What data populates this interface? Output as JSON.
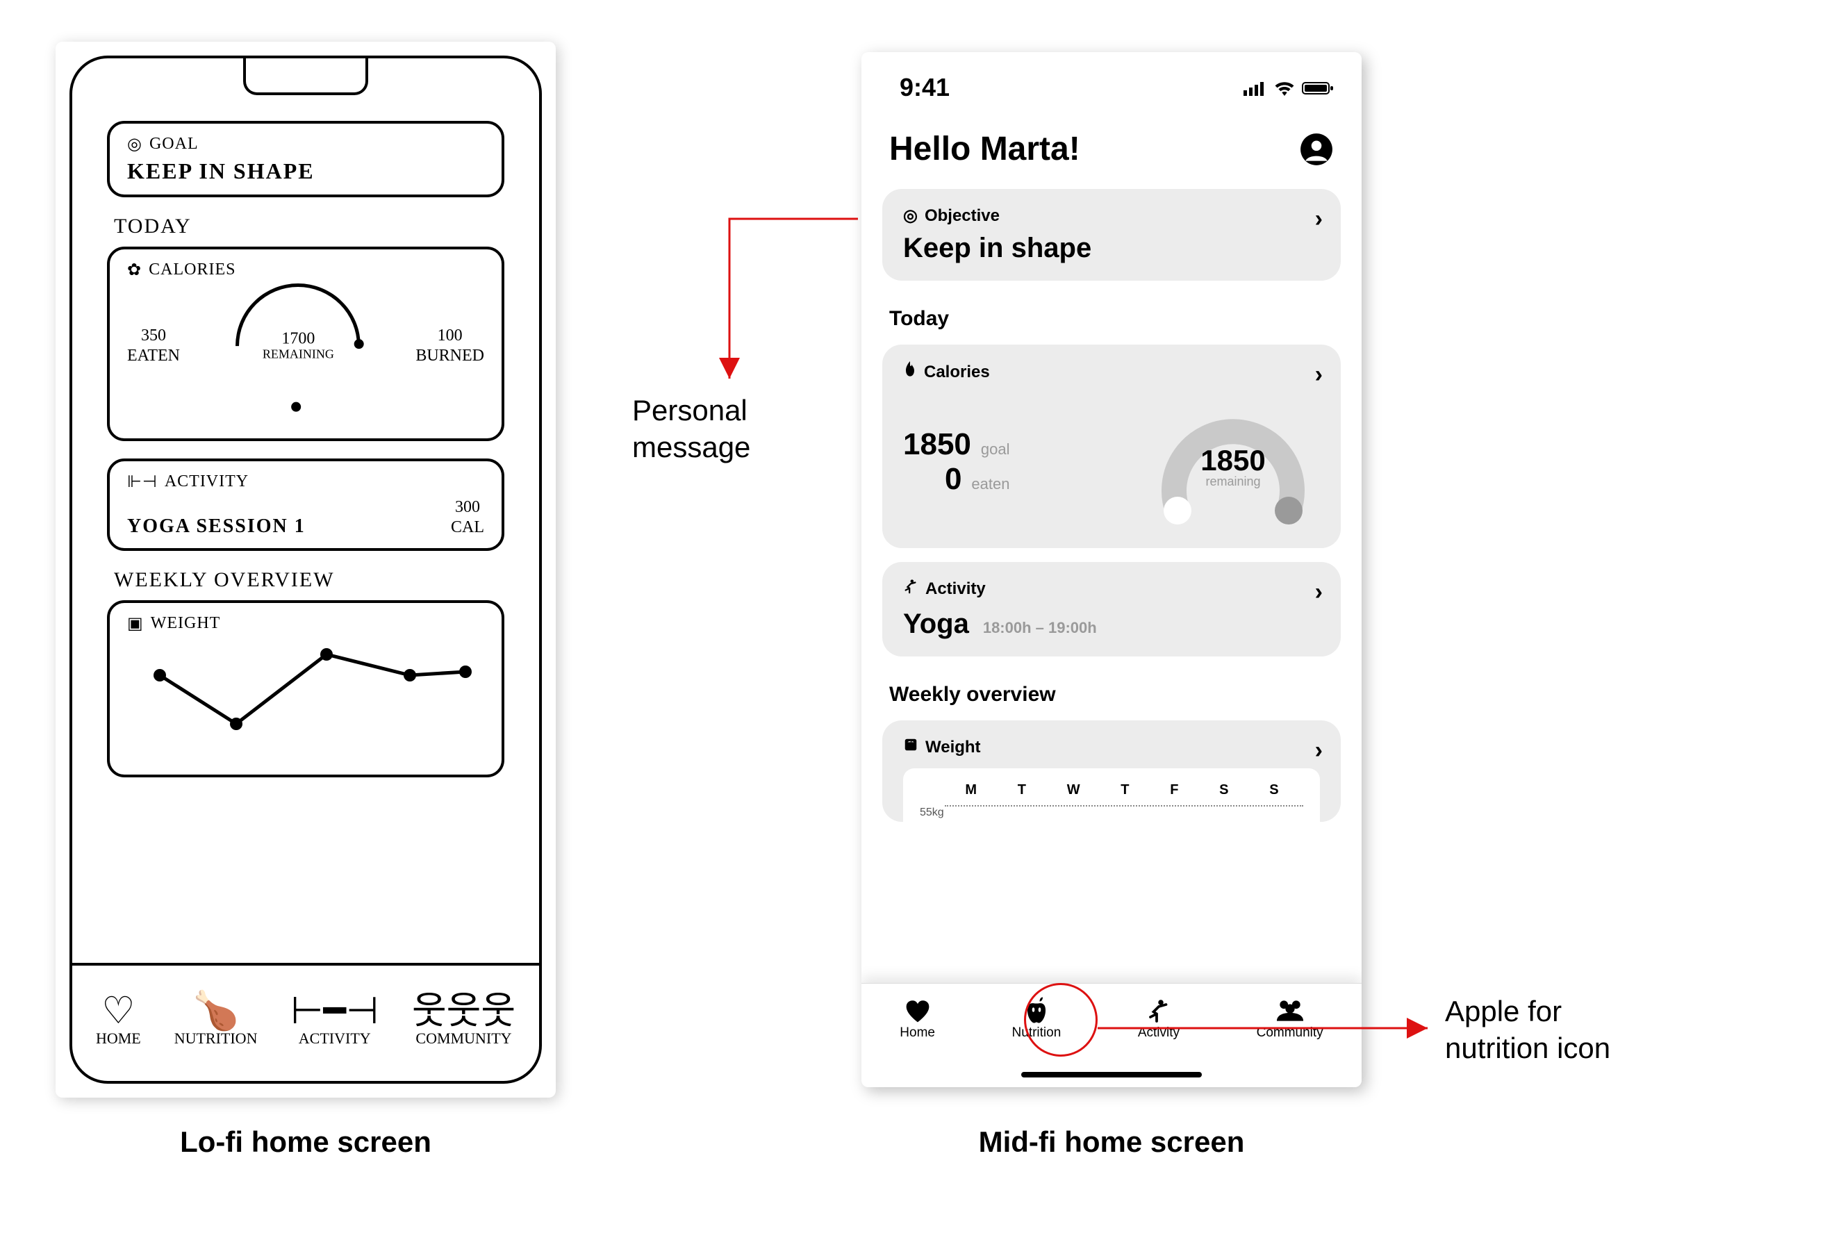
{
  "captions": {
    "lofi": "Lo-fi home screen",
    "midfi": "Mid-fi home screen"
  },
  "annotations": {
    "personal_message": "Personal\nmessage",
    "nutrition_icon": "Apple for\nnutrition icon"
  },
  "lofi": {
    "goal": {
      "label": "GOAL",
      "value": "KEEP IN SHAPE"
    },
    "today_heading": "TODAY",
    "calories": {
      "label": "CALORIES",
      "eaten": {
        "value": "350",
        "label": "EATEN"
      },
      "remaining": {
        "value": "1700",
        "label": "REMAINING"
      },
      "burned": {
        "value": "100",
        "label": "BURNED"
      }
    },
    "activity": {
      "label": "ACTIVITY",
      "name": "YOGA SESSION 1",
      "cal_value": "300",
      "cal_label": "CAL"
    },
    "weekly_heading": "WEEKLY OVERVIEW",
    "weight": {
      "label": "WEIGHT"
    },
    "tabs": {
      "home": "HOME",
      "nutrition": "NUTRITION",
      "activity": "ACTIVITY",
      "community": "COMMUNITY"
    }
  },
  "midfi": {
    "status_time": "9:41",
    "greeting": "Hello Marta!",
    "objective": {
      "label": "Objective",
      "value": "Keep in shape"
    },
    "today_heading": "Today",
    "calories": {
      "label": "Calories",
      "goal": {
        "value": "1850",
        "label": "goal"
      },
      "eaten": {
        "value": "0",
        "label": "eaten"
      },
      "remaining": {
        "value": "1850",
        "label": "remaining"
      }
    },
    "activity": {
      "label": "Activity",
      "name": "Yoga",
      "time": "18:00h – 19:00h"
    },
    "weekly_heading": "Weekly overview",
    "weight": {
      "label": "Weight",
      "days": [
        "M",
        "T",
        "W",
        "T",
        "F",
        "S",
        "S"
      ],
      "axis": "55kg"
    },
    "tabs": {
      "home": "Home",
      "nutrition": "Nutrition",
      "activity": "Activity",
      "community": "Community"
    }
  }
}
